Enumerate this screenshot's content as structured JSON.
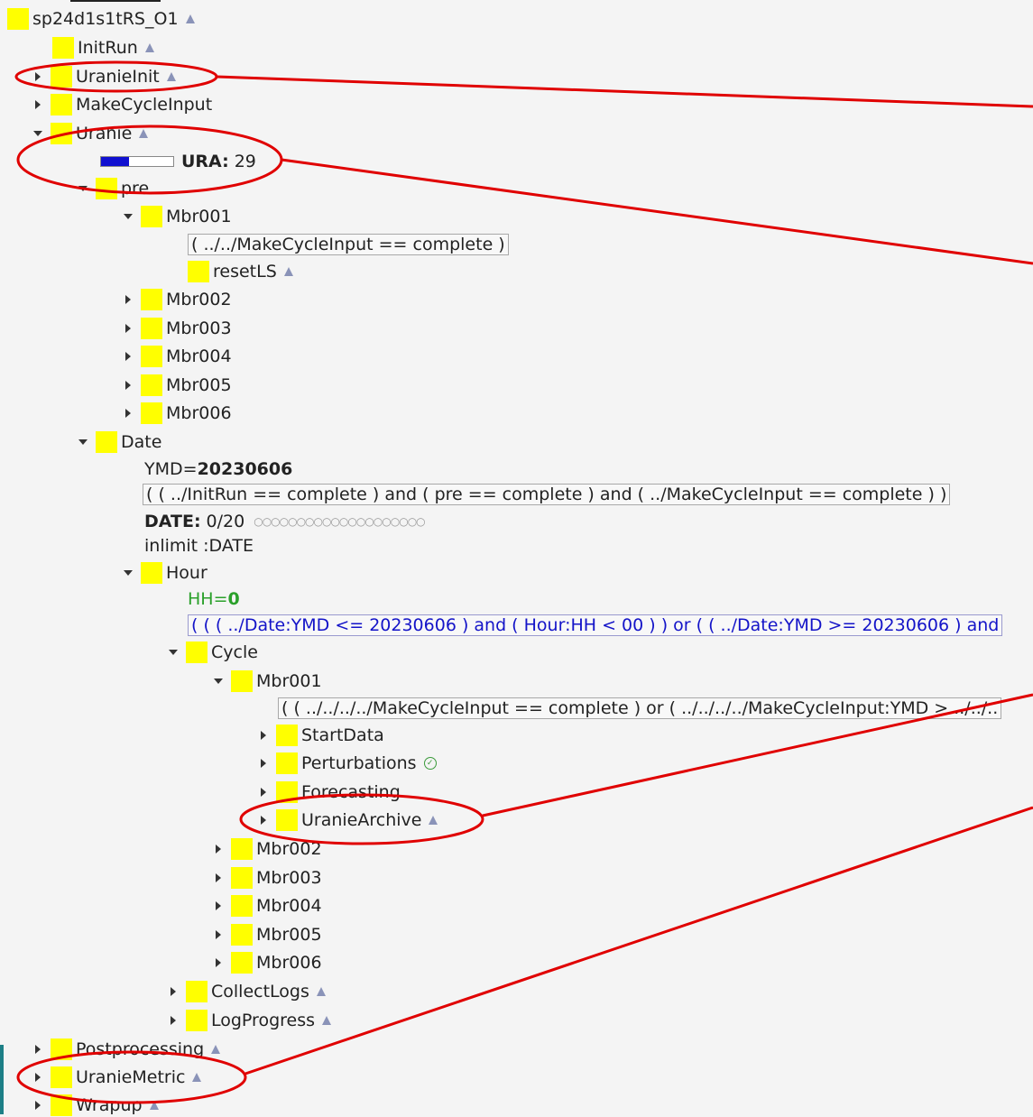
{
  "tree": {
    "root": "sp24d1s1tRS_O1",
    "init_run": "InitRun",
    "uranie_init": "UranieInit",
    "make_cycle_input": "MakeCycleInput",
    "uranie": "Uranie",
    "ura_meter": {
      "label": "URA:",
      "value": "29",
      "fill_fraction": 0.39
    },
    "pre": "pre",
    "pre_mbr001": "Mbr001",
    "pre_mbr001_trigger": "( ../../MakeCycleInput == complete )",
    "reset_ls": "resetLS",
    "pre_mbr002": "Mbr002",
    "pre_mbr003": "Mbr003",
    "pre_mbr004": "Mbr004",
    "pre_mbr005": "Mbr005",
    "pre_mbr006": "Mbr006",
    "date": "Date",
    "ymd_label": "YMD=",
    "ymd_value": "20230606",
    "date_trigger": "( ( ../InitRun == complete ) and ( pre == complete ) and ( ../MakeCycleInput == complete ) )",
    "date_limit_label": "DATE:",
    "date_limit_value": "0/20",
    "date_limit_slots": "○○○○○○○○○○○○○○○○○○○○",
    "inlimit": "inlimit :DATE",
    "hour": "Hour",
    "hh_label": "HH=",
    "hh_value": "0",
    "hour_trigger": "( ( ( ../Date:YMD <= 20230606 ) and ( Hour:HH < 00 ) ) or ( ( ../Date:YMD >= 20230606 ) and",
    "cycle": "Cycle",
    "cycle_mbr001": "Mbr001",
    "cycle_mbr001_trigger": "( ( ../../../../MakeCycleInput == complete ) or ( ../../../../MakeCycleInput:YMD > ../../..",
    "start_data": "StartData",
    "perturbations": "Perturbations",
    "forecasting": "Forecasting",
    "uranie_archive": "UranieArchive",
    "cycle_mbr002": "Mbr002",
    "cycle_mbr003": "Mbr003",
    "cycle_mbr004": "Mbr004",
    "cycle_mbr005": "Mbr005",
    "cycle_mbr006": "Mbr006",
    "collect_logs": "CollectLogs",
    "log_progress": "LogProgress",
    "postprocessing": "Postprocessing",
    "uranie_metric": "UranieMetric",
    "wrapup": "Wrapup"
  },
  "colors": {
    "node_queued": "#ffff00",
    "annotation": "#e00000",
    "meter_fill": "#1010d0",
    "trigger_blue": "#1414c8",
    "variable_green": "#2aa02a",
    "background": "#f4f4f4"
  },
  "icons": {
    "expanded": "triangle-down",
    "collapsed": "triangle-right",
    "has_children_marker": "triangle-up",
    "complete_marker": "check-circle"
  }
}
